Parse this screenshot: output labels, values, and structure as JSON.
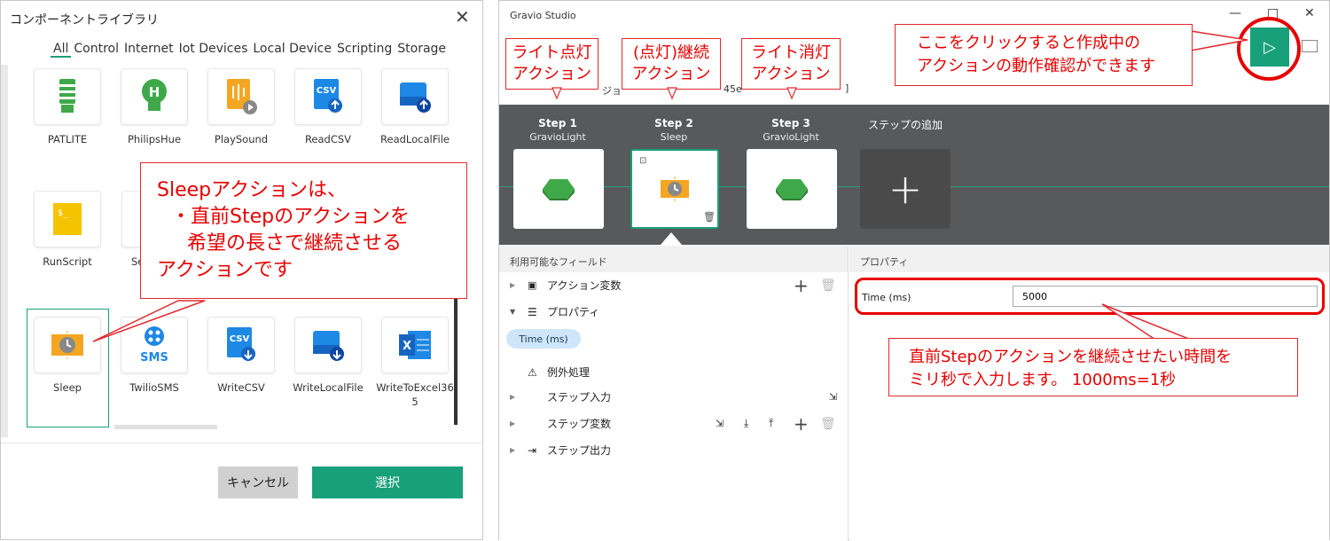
{
  "dialog": {
    "title": "コンポーネントライブラリ",
    "tabs": [
      "All",
      "Control",
      "Internet",
      "Iot Devices",
      "Local Device",
      "Scripting",
      "Storage"
    ],
    "components_row1": [
      "PATLITE",
      "PhilipsHue",
      "PlaySound",
      "ReadCSV",
      "ReadLocalFile"
    ],
    "components_row2": [
      "RunScript",
      "Se"
    ],
    "components_row3": [
      "Sleep",
      "TwilioSMS",
      "WriteCSV",
      "WriteLocalFile",
      "WriteToExcel365"
    ],
    "run_icon_text": "$_",
    "csv_label": "CSV",
    "sms_label": "SMS",
    "excel_label": "X",
    "cancel": "キャンセル",
    "select": "選択"
  },
  "callouts": {
    "sleep_lines": [
      "Sleepアクションは、",
      "・直前Stepのアクションを",
      "希望の長さで継続させる",
      "アクションです"
    ],
    "step1_lines": [
      "ライト点灯",
      "アクション"
    ],
    "step2_lines": [
      "(点灯)継続",
      "アクション"
    ],
    "step3_lines": [
      "ライト消灯",
      "アクション"
    ],
    "run_lines": [
      "ここをクリックすると作成中の",
      "アクションの動作確認ができます"
    ],
    "time_lines": [
      "直前Stepのアクションを継続させたい時間を",
      "ミリ秒で入力します。 1000ms=1秒"
    ]
  },
  "window": {
    "title": "Gravio Studio",
    "minimize": "—",
    "maximize": "□",
    "close": "✕",
    "play": "▷",
    "partial_text_left": "ジョ",
    "partial_text_right": "45e"
  },
  "steps": [
    {
      "name": "Step 1",
      "sub": "GravioLight"
    },
    {
      "name": "Step 2",
      "sub": "Sleep"
    },
    {
      "name": "Step 3",
      "sub": "GravioLight"
    }
  ],
  "add_step": "ステップの追加",
  "fields": {
    "header": "利用可能なフィールド",
    "action_vars": "アクション変数",
    "properties": "プロパティ",
    "time_chip": "Time (ms)",
    "exception": "例外処理",
    "step_input": "ステップ入力",
    "step_vars": "ステップ変数",
    "step_output": "ステップ出力"
  },
  "properties": {
    "header": "プロパティ",
    "time_label": "Time (ms)",
    "time_value": "5000"
  },
  "colors": {
    "accent": "#18a07a",
    "callout": "#e60000",
    "stepbar": "#58595b",
    "green": "#3fa94a",
    "orange": "#f4a623"
  }
}
